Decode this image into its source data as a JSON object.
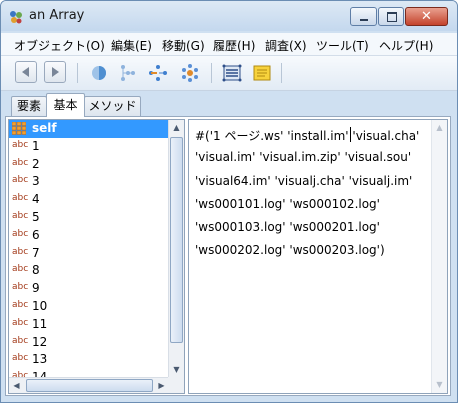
{
  "window": {
    "title": "an Array",
    "close_glyph": "✕"
  },
  "menu": [
    "オブジェクト(O)",
    "編集(E)",
    "移動(G)",
    "履歴(H)",
    "調査(X)",
    "ツール(T)",
    "ヘルプ(H)"
  ],
  "toolbar": {
    "icons": [
      "back-icon",
      "forward-icon",
      "inspect-icon",
      "hierarchy-icon",
      "references-icon",
      "explore-icon",
      "browse-icon",
      "notes-icon"
    ]
  },
  "tabs": [
    "要素",
    "基本",
    "メソッド"
  ],
  "active_tab": "基本",
  "left_list": {
    "selected": "self",
    "type_tag": "abc",
    "items": [
      "1",
      "2",
      "3",
      "4",
      "5",
      "6",
      "7",
      "8",
      "9",
      "10",
      "11",
      "12",
      "13"
    ],
    "partial_item": "14"
  },
  "value_text": [
    "#('1 ページ.ws' 'install.im' 'visual.cha'",
    "'visual.im' 'visual.im.zip' 'visual.sou'",
    "'visual64.im' 'visualj.cha' 'visualj.im'",
    "'ws000101.log' 'ws000102.log'",
    "'ws000103.log' 'ws000201.log'",
    "'ws000202.log' 'ws000203.log')"
  ],
  "colors": {
    "selection": "#3399ff",
    "type_tag": "#a33a1a",
    "titlebar": "#cfe0f1"
  }
}
